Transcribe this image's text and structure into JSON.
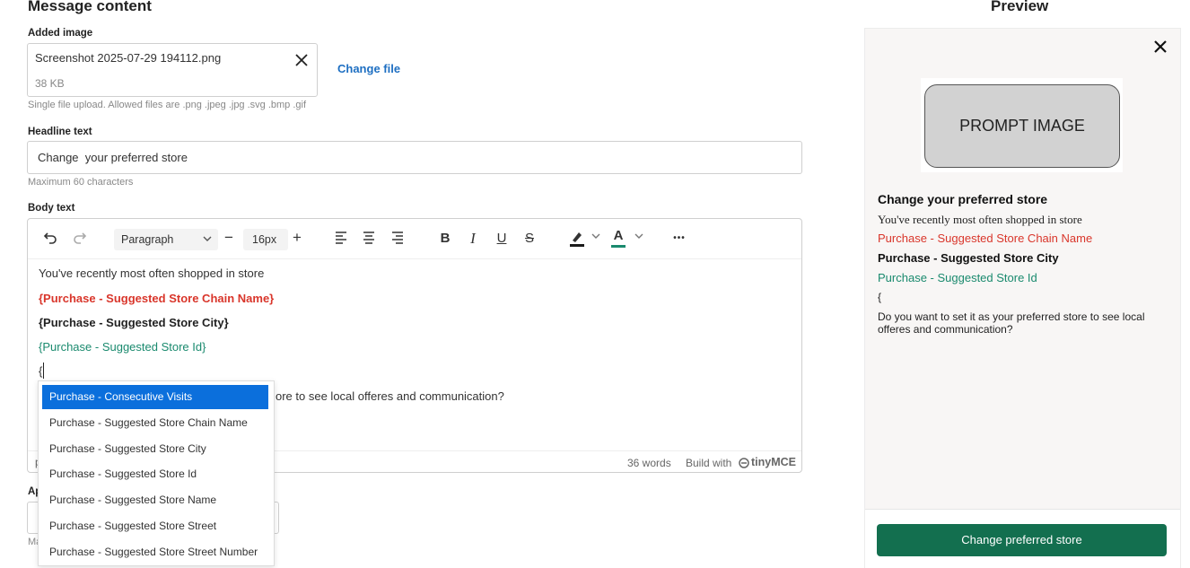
{
  "message_content": {
    "title": "Message content",
    "added_image_label": "Added image",
    "file_name": "Screenshot 2025-07-29 194112.png",
    "file_size": "38 KB",
    "change_file_label": "Change file",
    "file_hint": "Single file upload. Allowed files are .png .jpeg .jpg .svg .bmp .gif",
    "headline_label": "Headline text",
    "headline_value": "Change  your preferred store",
    "headline_hint": "Maximum 60 characters",
    "body_label": "Body text"
  },
  "toolbar": {
    "block_format": "Paragraph",
    "font_size": "16px",
    "minus": "−",
    "plus": "+",
    "bold": "B",
    "italic": "I",
    "underline": "U",
    "strike": "S",
    "text_color_letter": "A",
    "more": "•••",
    "highlight_color": "#1a1a1a",
    "text_color": "#1a8a6e"
  },
  "body": {
    "line1": "You've recently most often shopped in store",
    "line2": "{Purchase - Suggested Store Chain Name}",
    "line3": "{Purchase - Suggested Store City}",
    "line4": "{Purchase - Suggested Store Id}",
    "line5": "{",
    "line6_visible": "ore to see local offeres and communication?",
    "colors": {
      "red": "#d9362b",
      "green": "#1a8a6e"
    }
  },
  "status": {
    "path_char": "p",
    "word_count": "36 words",
    "build_with": "Build with",
    "brand": "tinyMCE"
  },
  "dropdown": {
    "items": [
      "Purchase - Consecutive Visits",
      "Purchase - Suggested Store Chain Name",
      "Purchase - Suggested Store City",
      "Purchase - Suggested Store Id",
      "Purchase - Suggested Store Name",
      "Purchase - Suggested Store Street",
      "Purchase - Suggested Store Street Number"
    ],
    "active_color": "#0b6fdc"
  },
  "below": {
    "label_partial": "Ap",
    "hint_partial": "Ma"
  },
  "preview": {
    "title": "Preview",
    "close": "✕",
    "image_text": "PROMPT IMAGE",
    "headline": "Change your preferred store",
    "line1": "You've recently most often shopped in store",
    "line2": "Purchase - Suggested Store Chain Name",
    "line3": "Purchase - Suggested Store City",
    "line4": "Purchase - Suggested Store Id",
    "line5": "{",
    "line6": "Do you want to set it as your preferred store to see local offeres and communication?",
    "button_label": "Change preferred store",
    "button_color": "#136f4f"
  }
}
